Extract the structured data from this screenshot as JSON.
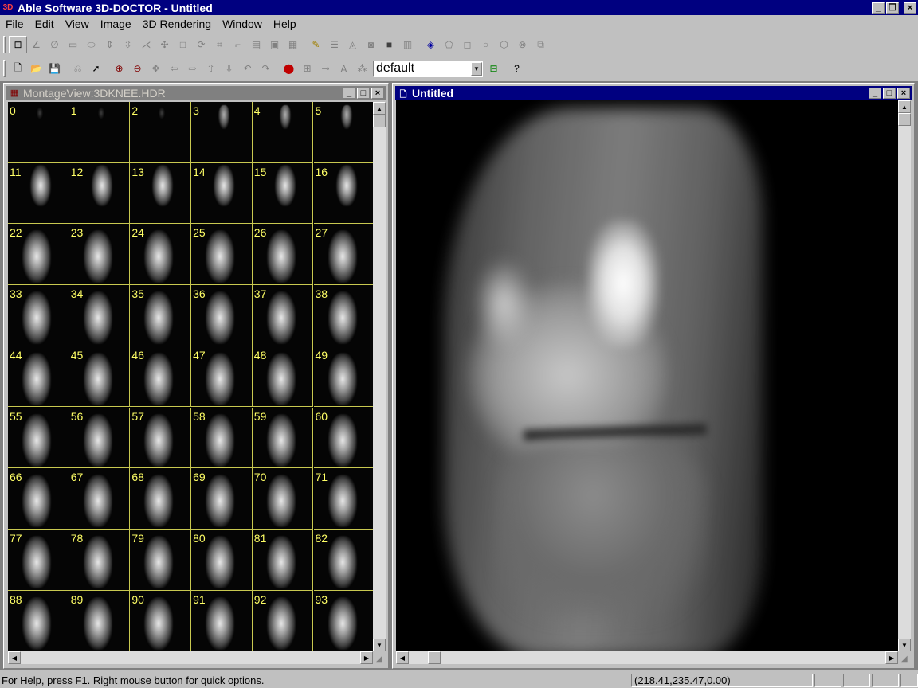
{
  "app": {
    "title": "Able Software 3D-DOCTOR - Untitled",
    "icon": "3D"
  },
  "menu": [
    "File",
    "Edit",
    "View",
    "Image",
    "3D Rendering",
    "Window",
    "Help"
  ],
  "toolbar": {
    "profile_value": "default"
  },
  "montage_window": {
    "title": "MontageView:3DKNEE.HDR"
  },
  "image_window": {
    "title": "Untitled"
  },
  "slices": [
    [
      "0",
      "1",
      "2",
      "3",
      "4",
      "5"
    ],
    [
      "11",
      "12",
      "13",
      "14",
      "15",
      "16"
    ],
    [
      "22",
      "23",
      "24",
      "25",
      "26",
      "27"
    ],
    [
      "33",
      "34",
      "35",
      "36",
      "37",
      "38"
    ],
    [
      "44",
      "45",
      "46",
      "47",
      "48",
      "49"
    ],
    [
      "55",
      "56",
      "57",
      "58",
      "59",
      "60"
    ],
    [
      "66",
      "67",
      "68",
      "69",
      "70",
      "71"
    ],
    [
      "77",
      "78",
      "79",
      "80",
      "81",
      "82"
    ],
    [
      "88",
      "89",
      "90",
      "91",
      "92",
      "93"
    ]
  ],
  "status": {
    "help_text": "For Help, press F1. Right mouse button for quick options.",
    "coords": "(218.41,235.47,0.00)"
  },
  "caption_buttons": {
    "minimize": "_",
    "maximize": "□",
    "restore": "❐",
    "close": "×"
  }
}
